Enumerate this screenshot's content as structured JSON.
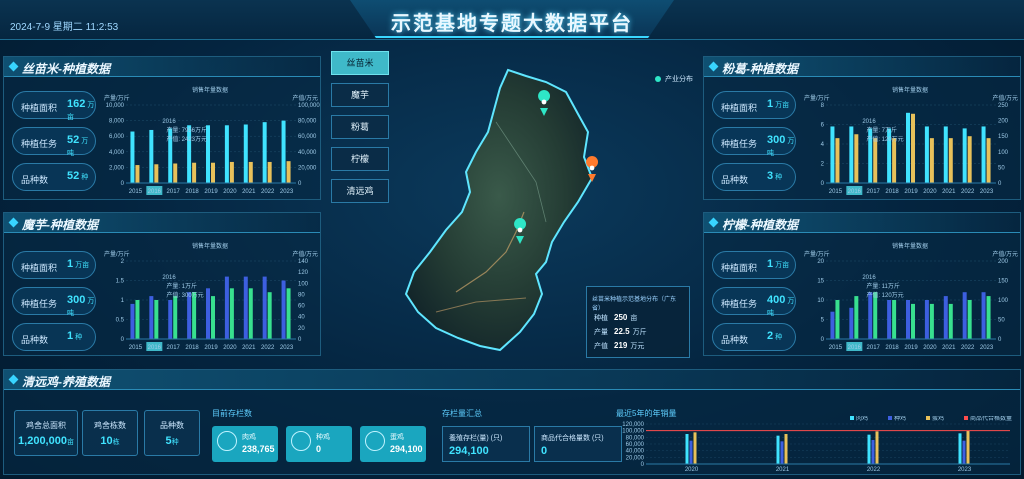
{
  "header": {
    "datetime": "2024-7-9 星期二 11:2:53",
    "title": "示范基地专题大数据平台"
  },
  "colors": {
    "accent": "#40e3ff",
    "gold": "#e8c15a",
    "blue": "#3d5fe0",
    "green": "#38e08f",
    "teal": "#3fb9c9",
    "orange": "#ff7a2d",
    "red": "#ff4d4d"
  },
  "panels": {
    "simiao": {
      "title": "丝苗米-种植数据",
      "stats": [
        {
          "label": "种植面积",
          "value": "162",
          "unit": "万亩"
        },
        {
          "label": "种植任务",
          "value": "52",
          "unit": "万吨"
        },
        {
          "label": "品种数",
          "value": "52",
          "unit": "种"
        }
      ],
      "chart_title": "销售年量数据",
      "left_axis_unit": "产量/万斤",
      "right_axis_unit": "产值/万元",
      "tooltip": {
        "year": "2016",
        "l1": "产量: 7956万斤",
        "l2": "产值: 2423万元"
      }
    },
    "moyu": {
      "title": "魔芋-种植数据",
      "stats": [
        {
          "label": "种植面积",
          "value": "1",
          "unit": "万亩"
        },
        {
          "label": "种植任务",
          "value": "300",
          "unit": "万吨"
        },
        {
          "label": "品种数",
          "value": "1",
          "unit": "种"
        }
      ],
      "chart_title": "销售年量数据",
      "left_axis_unit": "产量/万斤",
      "right_axis_unit": "产值/万元",
      "tooltip": {
        "year": "2016",
        "l1": "产量: 1万斤",
        "l2": "产值: 300万元"
      }
    },
    "fenge": {
      "title": "粉葛-种植数据",
      "stats": [
        {
          "label": "种植面积",
          "value": "1",
          "unit": "万亩"
        },
        {
          "label": "种植任务",
          "value": "300",
          "unit": "万吨"
        },
        {
          "label": "品种数",
          "value": "3",
          "unit": "种"
        }
      ],
      "chart_title": "销售年量数据",
      "left_axis_unit": "产量/万斤",
      "right_axis_unit": "产值/万元",
      "tooltip": {
        "year": "2016",
        "l1": "产量: 7万斤",
        "l2": "产值: 120万元"
      }
    },
    "ningmeng": {
      "title": "柠檬-种植数据",
      "stats": [
        {
          "label": "种植面积",
          "value": "1",
          "unit": "万亩"
        },
        {
          "label": "种植任务",
          "value": "400",
          "unit": "万吨"
        },
        {
          "label": "品种数",
          "value": "2",
          "unit": "种"
        }
      ],
      "chart_title": "销售年量数据",
      "left_axis_unit": "产量/万斤",
      "right_axis_unit": "产值/万元",
      "tooltip": {
        "year": "2016",
        "l1": "产量: 11万斤",
        "l2": "产值: 120万元"
      }
    }
  },
  "category_buttons": [
    "丝苗米",
    "魔芋",
    "粉葛",
    "柠檬",
    "清远鸡"
  ],
  "active_button": 0,
  "map": {
    "legend": "产业分布",
    "info": {
      "heading": "丝苗米种植示范基地分布（广东省）",
      "rows": [
        {
          "label": "种植",
          "value": "250",
          "unit": "亩"
        },
        {
          "label": "产量",
          "value": "22.5",
          "unit": "万斤"
        },
        {
          "label": "产值",
          "value": "219",
          "unit": "万元"
        }
      ]
    }
  },
  "bottom": {
    "title": "清远鸡-养殖数据",
    "stats": [
      {
        "label": "鸡舍总面积",
        "value": "1,200,000",
        "unit": "亩"
      },
      {
        "label": "鸡舍栋数",
        "value": "10",
        "unit": "栋"
      },
      {
        "label": "品种数",
        "value": "5",
        "unit": "种"
      }
    ],
    "stock_title": "目前存栏数",
    "stock": [
      {
        "label": "肉鸡",
        "value": "238,765"
      },
      {
        "label": "种鸡",
        "value": "0"
      },
      {
        "label": "蛋鸡",
        "value": "294,100"
      }
    ],
    "summary_title": "存栏量汇总",
    "summary": [
      {
        "label": "養殖存栏(量)",
        "value": "294,100",
        "unit": "(只)"
      },
      {
        "label": "商品代合格量数",
        "value": "0",
        "unit": "(只)"
      }
    ],
    "sales_title": "最近5年的年销量",
    "sales_legend": [
      "肉鸡",
      "种鸡",
      "蛋鸡",
      "商品代合格数量"
    ]
  },
  "chart_data": [
    {
      "type": "bar",
      "name": "simiao",
      "categories": [
        "2015",
        "2016",
        "2017",
        "2018",
        "2019",
        "2020",
        "2021",
        "2022",
        "2023"
      ],
      "series": [
        {
          "values": [
            6600,
            6800,
            7000,
            7400,
            7400,
            7400,
            7500,
            7800,
            8000
          ]
        },
        {
          "values": [
            2300,
            2400,
            2500,
            2600,
            2600,
            2700,
            2700,
            2700,
            2800
          ]
        }
      ],
      "yticks": [
        "0",
        "2,000",
        "4,000",
        "6,000",
        "8,000",
        "10,000"
      ],
      "y2ticks": [
        "0",
        "20,000",
        "40,000",
        "60,000",
        "80,000",
        "100,000"
      ],
      "ylim": [
        0,
        10000
      ]
    },
    {
      "type": "bar",
      "name": "moyu",
      "categories": [
        "2015",
        "2016",
        "2017",
        "2018",
        "2019",
        "2020",
        "2021",
        "2022",
        "2023"
      ],
      "series": [
        {
          "values": [
            0.9,
            1.1,
            1.0,
            1.2,
            1.3,
            1.6,
            1.6,
            1.6,
            1.5
          ]
        },
        {
          "values": [
            1.0,
            1.0,
            1.1,
            1.2,
            1.1,
            1.3,
            1.3,
            1.2,
            1.3
          ]
        }
      ],
      "yticks": [
        "0",
        "0.5",
        "1",
        "1.5",
        "2"
      ],
      "y2ticks": [
        "0",
        "20",
        "40",
        "60",
        "80",
        "100",
        "120",
        "140"
      ],
      "ylim": [
        0,
        2
      ]
    },
    {
      "type": "bar",
      "name": "fenge",
      "categories": [
        "2015",
        "2016",
        "2017",
        "2018",
        "2019",
        "2020",
        "2021",
        "2022",
        "2023"
      ],
      "series": [
        {
          "values": [
            5.8,
            5.8,
            5.6,
            5.6,
            7.2,
            5.8,
            5.8,
            5.6,
            5.8
          ]
        },
        {
          "values": [
            4.6,
            5.0,
            4.6,
            4.6,
            7.1,
            4.6,
            4.6,
            4.8,
            4.6
          ]
        }
      ],
      "yticks": [
        "0",
        "2",
        "4",
        "6",
        "8"
      ],
      "y2ticks": [
        "0",
        "50",
        "100",
        "150",
        "200",
        "250"
      ],
      "ylim": [
        0,
        8
      ]
    },
    {
      "type": "bar",
      "name": "ningmeng",
      "categories": [
        "2015",
        "2016",
        "2017",
        "2018",
        "2019",
        "2020",
        "2021",
        "2022",
        "2023"
      ],
      "series": [
        {
          "values": [
            7,
            8,
            12,
            10,
            10,
            10,
            11,
            12,
            12
          ]
        },
        {
          "values": [
            10,
            11,
            12,
            10,
            9,
            9,
            9,
            10,
            11
          ]
        }
      ],
      "yticks": [
        "0",
        "5",
        "10",
        "15",
        "20"
      ],
      "y2ticks": [
        "0",
        "50",
        "100",
        "150",
        "200"
      ],
      "ylim": [
        0,
        20
      ]
    },
    {
      "type": "bar",
      "name": "qingyuanji_sales",
      "categories": [
        "2020",
        "2021",
        "2022",
        "2023"
      ],
      "series": [
        {
          "values": [
            90000,
            85000,
            88000,
            92000
          ]
        },
        {
          "values": [
            70000,
            68000,
            72000,
            70000
          ]
        },
        {
          "values": [
            95000,
            90000,
            98000,
            100000
          ]
        }
      ],
      "line": [
        100000,
        100000,
        100000,
        100000
      ],
      "yticks": [
        "0",
        "20,000",
        "40,000",
        "60,000",
        "80,000",
        "100,000",
        "120,000"
      ],
      "ylim": [
        0,
        120000
      ]
    }
  ]
}
